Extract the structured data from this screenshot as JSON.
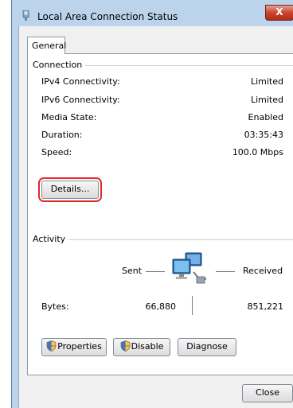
{
  "window": {
    "title": "Local Area Connection Status",
    "close_glyph": "X"
  },
  "tabs": [
    {
      "label": "General",
      "active": true
    }
  ],
  "connection": {
    "group_label": "Connection",
    "rows": [
      {
        "label": "IPv4 Connectivity:",
        "value": "Limited"
      },
      {
        "label": "IPv6 Connectivity:",
        "value": "Limited"
      },
      {
        "label": "Media State:",
        "value": "Enabled"
      },
      {
        "label": "Duration:",
        "value": "03:35:43"
      },
      {
        "label": "Speed:",
        "value": "100.0 Mbps"
      }
    ],
    "details_label": "Details..."
  },
  "activity": {
    "group_label": "Activity",
    "sent_label": "Sent",
    "received_label": "Received",
    "bytes_label": "Bytes:",
    "bytes_sent": "66,880",
    "bytes_received": "851,221"
  },
  "buttons": {
    "properties": "Properties",
    "disable": "Disable",
    "diagnose": "Diagnose",
    "close": "Close"
  },
  "icons": {
    "title": "network-connection-icon",
    "shield": "uac-shield-icon",
    "activity": "network-computers-icon"
  },
  "colors": {
    "highlight": "#e02a2a",
    "titlebar": "#bcd3ec",
    "close_button": "#c8452e"
  }
}
